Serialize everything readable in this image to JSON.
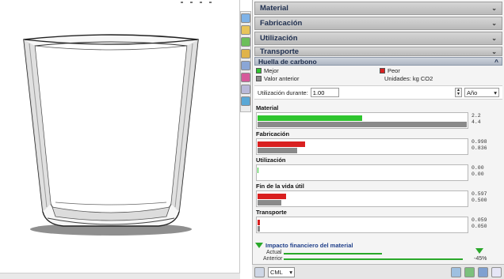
{
  "sections": [
    {
      "label": "Material",
      "chevron": "⌄"
    },
    {
      "label": "Fabricación",
      "chevron": "⌄"
    },
    {
      "label": "Utilización",
      "chevron": "⌄"
    },
    {
      "label": "Transporte",
      "chevron": "⌄"
    }
  ],
  "huella": {
    "title": "Huella de carbono",
    "chevron": "^",
    "legend": {
      "better": "Mejor",
      "worse": "Peor",
      "previous": "Valor anterior",
      "units": "Unidades: kg CO2"
    },
    "usage": {
      "label": "Utilización durante:",
      "value": "1.00",
      "unit_selected": "Año"
    },
    "metrics": [
      {
        "title": "Material",
        "current": "2.2",
        "previous": "4.4",
        "current_fraction": 0.5,
        "previous_fraction": 1.0,
        "color": "#2ec52e"
      },
      {
        "title": "Fabricación",
        "current": "0.998",
        "previous": "0.836",
        "current_fraction": 0.227,
        "previous_fraction": 0.19,
        "color": "#d92020"
      },
      {
        "title": "Utilización",
        "current": "0.00",
        "previous": "0.00",
        "current_fraction": 0.004,
        "previous_fraction": 0.0,
        "color": "#2ec52e"
      },
      {
        "title": "Fin de la vida útil",
        "current": "0.597",
        "previous": "0.500",
        "current_fraction": 0.136,
        "previous_fraction": 0.114,
        "color": "#d92020"
      },
      {
        "title": "Transporte",
        "current": "0.059",
        "previous": "0.050",
        "current_fraction": 0.013,
        "previous_fraction": 0.011,
        "color": "#d92020"
      }
    ]
  },
  "impact": {
    "title": "Impacto financiero del material",
    "actual_label": "Actual",
    "previous_label": "Anterior",
    "percent": "-45%",
    "actual_fraction": 0.55,
    "previous_fraction": 1.0
  },
  "bottombar": {
    "combo_value": "CML"
  },
  "colors": {
    "better": "#2ec52e",
    "worse": "#d92020",
    "previous": "#8a8a8a",
    "impact_line": "#2aa82a"
  }
}
